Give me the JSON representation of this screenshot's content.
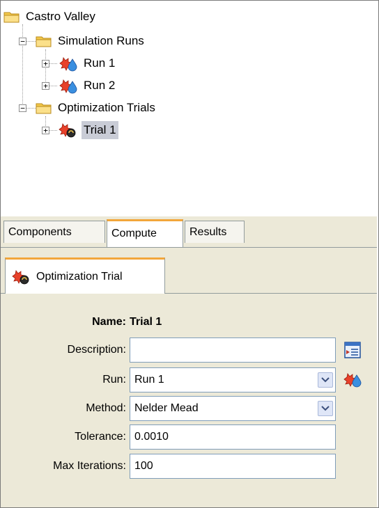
{
  "tree": {
    "root": {
      "label": "Castro Valley"
    },
    "simulation_runs": {
      "label": "Simulation Runs",
      "items": [
        {
          "label": "Run 1"
        },
        {
          "label": "Run 2"
        }
      ]
    },
    "optimization_trials": {
      "label": "Optimization Trials",
      "items": [
        {
          "label": "Trial 1",
          "selected": true
        }
      ]
    },
    "expander_collapsed": "+",
    "expander_expanded": "−"
  },
  "tabs": [
    {
      "label": "Components"
    },
    {
      "label": "Compute",
      "active": true
    },
    {
      "label": "Results"
    }
  ],
  "editor": {
    "tab_label": "Optimization Trial",
    "name_label": "Name:",
    "name_value": "Trial 1",
    "description_label": "Description:",
    "description_value": "",
    "run_label": "Run:",
    "run_value": "Run 1",
    "method_label": "Method:",
    "method_value": "Nelder Mead",
    "tolerance_label": "Tolerance:",
    "tolerance_value": "0.0010",
    "max_iterations_label": "Max Iterations:",
    "max_iterations_value": "100"
  },
  "icons": {
    "folder": "folder-icon",
    "run": "simulation-run-icon",
    "trial": "optimization-trial-icon",
    "description_editor": "description-editor-icon",
    "dropdown": "chevron-down-icon"
  },
  "colors": {
    "selection": "#c9ccd6",
    "tab_accent": "#f2a63a",
    "panel_bg": "#ece9d8",
    "folder": "#f3c94b"
  }
}
